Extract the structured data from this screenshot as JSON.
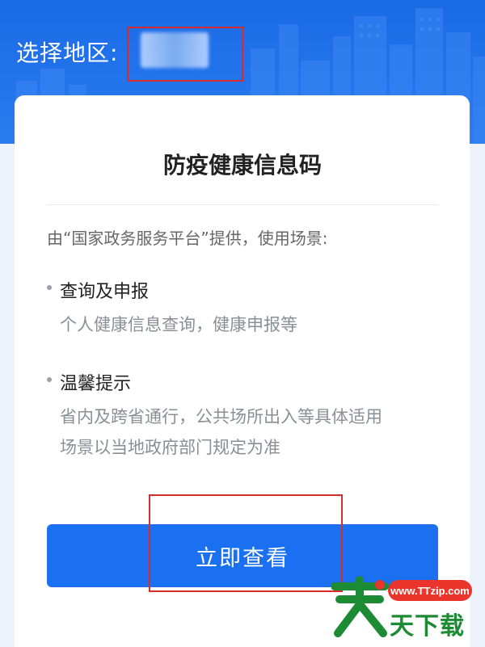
{
  "header": {
    "region_label": "选择地区:",
    "region_value": ""
  },
  "card": {
    "title": "防疫健康信息码",
    "intro": "由“国家政务服务平台”提供，使用场景:",
    "items": [
      {
        "title": "查询及申报",
        "desc_lines": [
          "个人健康信息查询，健康申报等"
        ]
      },
      {
        "title": "温馨提示",
        "desc_lines": [
          "省内及跨省通行，公共场所出入等具体适用",
          "场景以当地政府部门规定为准"
        ]
      }
    ],
    "button_label": "立即查看"
  },
  "watermark": {
    "url": "www.TTzip.com",
    "text": "天下载"
  },
  "colors": {
    "header_blue": "#1a6ae6",
    "button_blue": "#1a70f0",
    "highlight_red": "#d62c2c",
    "watermark_green": "#1d8a34"
  }
}
